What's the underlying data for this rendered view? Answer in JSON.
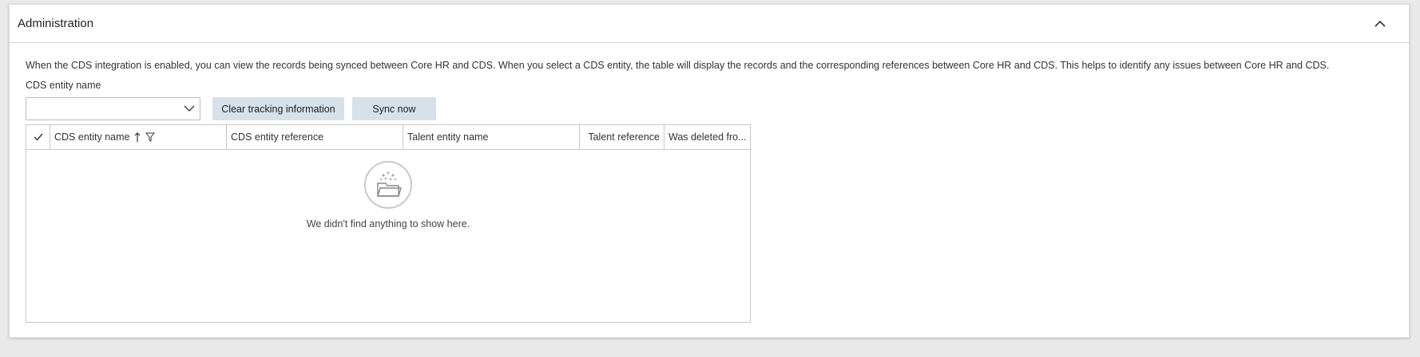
{
  "panel": {
    "title": "Administration",
    "intro": "When the CDS integration is enabled, you can view the records being synced between Core HR and CDS. When you select a CDS entity, the table will display the records and the corresponding references between Core HR and CDS. This helps to identify any issues between Core HR and CDS.",
    "field_label": "CDS entity name",
    "combo_value": ""
  },
  "buttons": {
    "clear": "Clear tracking information",
    "sync": "Sync now"
  },
  "grid": {
    "columns": {
      "name": "CDS entity name",
      "reference": "CDS entity reference",
      "talent_name": "Talent entity name",
      "talent_reference": "Talent reference",
      "deleted": "Was deleted fro..."
    },
    "empty_message": "We didn't find anything to show here."
  },
  "icons": {
    "collapse": "chevron-up-icon",
    "dropdown": "chevron-down-icon",
    "select_all": "checkmark-icon",
    "sort": "sort-ascending-icon",
    "filter": "filter-icon",
    "empty": "empty-folder-icon"
  }
}
